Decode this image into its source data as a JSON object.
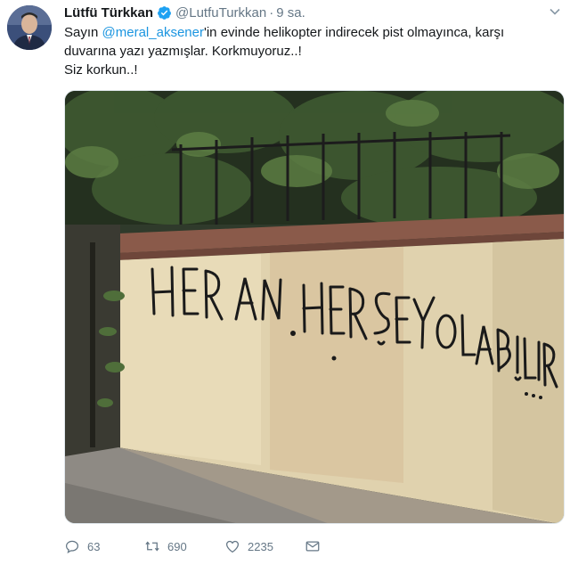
{
  "author": {
    "name": "Lütfü Türkkan",
    "handle": "@LutfuTurkkan",
    "separator": "·",
    "time": "9 sa."
  },
  "tweet": {
    "text_before": "Sayın ",
    "mention": "@meral_aksener",
    "text_after": "'in evinde helikopter indirecek pist olmayınca, karşı duvarına yazı yazmışlar. Korkmuyoruz..!",
    "line2": "Siz korkun..!"
  },
  "media": {
    "graffiti_text": "HER AN HERŞEY OLABİLİR..."
  },
  "actions": {
    "replies": "63",
    "retweets": "690",
    "likes": "2235"
  },
  "colors": {
    "link": "#1b95e0",
    "muted": "#657786",
    "verified": "#1da1f2"
  },
  "icons": {
    "verified": "verified-badge-icon",
    "reply": "reply-icon",
    "retweet": "retweet-icon",
    "like": "heart-icon",
    "dm": "envelope-icon",
    "menu": "chevron-down-icon"
  }
}
